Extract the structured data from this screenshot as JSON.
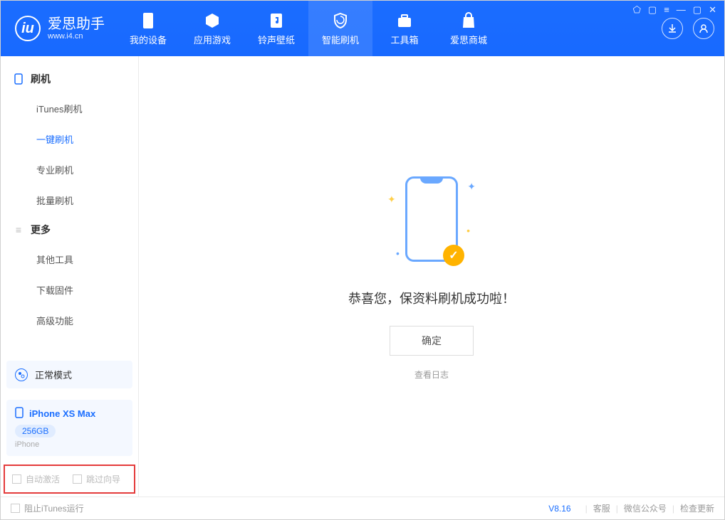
{
  "app": {
    "name": "爱思助手",
    "url": "www.i4.cn"
  },
  "tabs": [
    {
      "label": "我的设备"
    },
    {
      "label": "应用游戏"
    },
    {
      "label": "铃声壁纸"
    },
    {
      "label": "智能刷机"
    },
    {
      "label": "工具箱"
    },
    {
      "label": "爱思商城"
    }
  ],
  "sidebar": {
    "group1_title": "刷机",
    "items1": [
      {
        "label": "iTunes刷机"
      },
      {
        "label": "一键刷机"
      },
      {
        "label": "专业刷机"
      },
      {
        "label": "批量刷机"
      }
    ],
    "group2_title": "更多",
    "items2": [
      {
        "label": "其他工具"
      },
      {
        "label": "下载固件"
      },
      {
        "label": "高级功能"
      }
    ],
    "mode": "正常模式",
    "device_name": "iPhone XS Max",
    "device_storage": "256GB",
    "device_type": "iPhone",
    "chk_auto_activate": "自动激活",
    "chk_skip_guide": "跳过向导"
  },
  "main": {
    "success_msg": "恭喜您，保资料刷机成功啦！",
    "confirm_label": "确定",
    "log_link": "查看日志"
  },
  "footer": {
    "stop_itunes": "阻止iTunes运行",
    "version": "V8.16",
    "link_service": "客服",
    "link_wechat": "微信公众号",
    "link_update": "检查更新"
  }
}
